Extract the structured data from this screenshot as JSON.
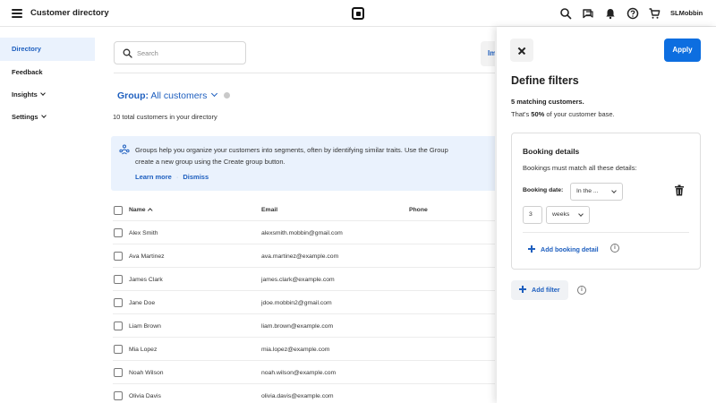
{
  "header": {
    "title": "Customer directory",
    "username": "SLMobbin",
    "icons": [
      "search-icon",
      "chat-icon",
      "bell-icon",
      "help-icon",
      "cart-icon"
    ]
  },
  "sidebar": {
    "items": [
      {
        "label": "Directory",
        "active": true,
        "has_chevron": false
      },
      {
        "label": "Feedback",
        "active": false,
        "has_chevron": false
      },
      {
        "label": "Insights",
        "active": false,
        "has_chevron": true
      },
      {
        "label": "Settings",
        "active": false,
        "has_chevron": true
      }
    ]
  },
  "main": {
    "search_placeholder": "Search",
    "import_label": "Im",
    "group_label": "Group:",
    "group_value": "All customers",
    "total_text": "10 total customers in your directory",
    "banner": {
      "line1": "Groups help you organize your customers into segments, often by identifying similar traits. Use the Group",
      "line2": "create a new group using the Create group button.",
      "learn_more": "Learn more",
      "separator": "·",
      "dismiss": "Dismiss"
    },
    "table": {
      "headers": {
        "name": "Name",
        "email": "Email",
        "phone": "Phone"
      },
      "rows": [
        {
          "name": "Alex Smith",
          "email": "alexsmith.mobbin@gmail.com",
          "phone": ""
        },
        {
          "name": "Ava Martinez",
          "email": "ava.martinez@example.com",
          "phone": ""
        },
        {
          "name": "James Clark",
          "email": "james.clark@example.com",
          "phone": ""
        },
        {
          "name": "Jane Doe",
          "email": "jdoe.mobbin2@gmail.com",
          "phone": ""
        },
        {
          "name": "Liam Brown",
          "email": "liam.brown@example.com",
          "phone": ""
        },
        {
          "name": "Mia Lopez",
          "email": "mia.lopez@example.com",
          "phone": ""
        },
        {
          "name": "Noah Wilson",
          "email": "noah.wilson@example.com",
          "phone": ""
        },
        {
          "name": "Olivia Davis",
          "email": "olivia.davis@example.com",
          "phone": ""
        }
      ]
    }
  },
  "drawer": {
    "apply_label": "Apply",
    "title": "Define filters",
    "match_count": "5 matching customers.",
    "match_base_prefix": "That's ",
    "match_base_percent": "50%",
    "match_base_suffix": " of your customer base.",
    "card": {
      "title": "Booking details",
      "subtitle": "Bookings must match all these details:",
      "booking_date_label": "Booking date:",
      "booking_date_value": "In the ...",
      "amount_value": "3",
      "unit_value": "weeks",
      "add_detail_label": "Add booking detail"
    },
    "add_filter_label": "Add filter",
    "info_glyph": "i"
  },
  "colors": {
    "accent": "#0d6ee0",
    "link": "#1e5fbf",
    "active_bg": "#eaf2fd",
    "banner_bg": "#eaf2fd"
  }
}
